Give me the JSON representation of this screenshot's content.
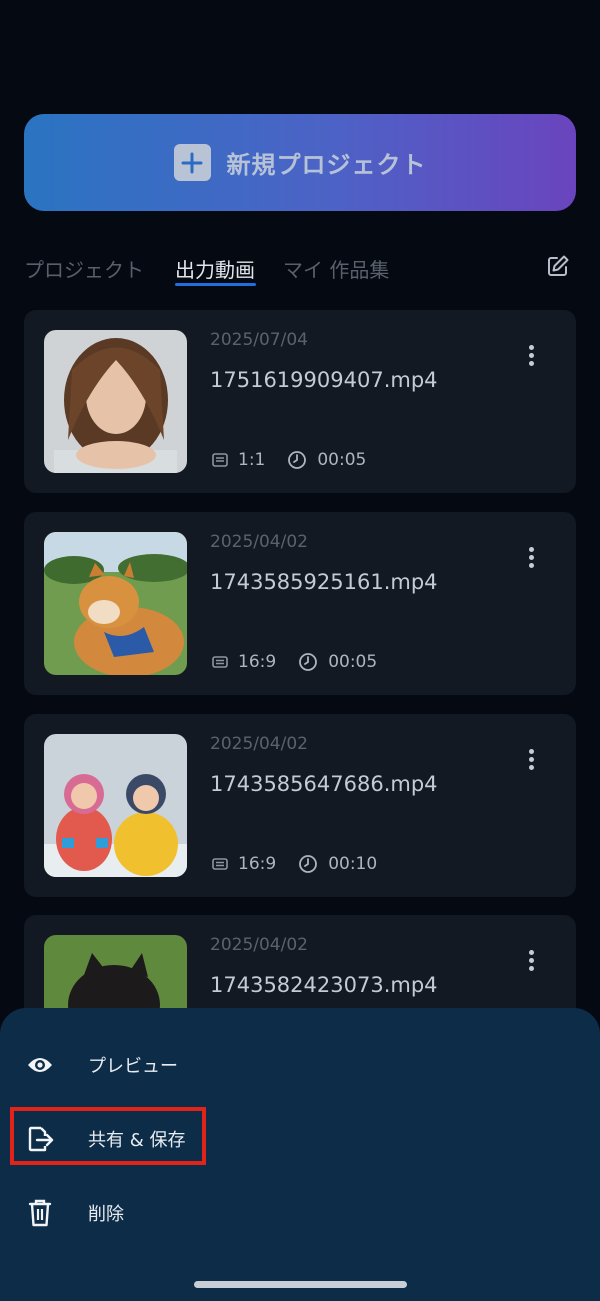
{
  "header": {
    "new_project_label": "新規プロジェクト"
  },
  "tabs": [
    {
      "label": "プロジェクト",
      "active": false
    },
    {
      "label": "出力動画",
      "active": true
    },
    {
      "label": "マイ 作品集",
      "active": false
    }
  ],
  "videos": [
    {
      "date": "2025/07/04",
      "filename": "1751619909407.mp4",
      "ratio": "1:1",
      "duration": "00:05",
      "thumb": "woman-portrait"
    },
    {
      "date": "2025/04/02",
      "filename": "1743585925161.mp4",
      "ratio": "16:9",
      "duration": "00:05",
      "thumb": "shiba-dog"
    },
    {
      "date": "2025/04/02",
      "filename": "1743585647686.mp4",
      "ratio": "16:9",
      "duration": "00:10",
      "thumb": "kids-in-snow"
    },
    {
      "date": "2025/04/02",
      "filename": "1743582423073.mp4",
      "ratio": "",
      "duration": "",
      "thumb": "black-shiba-dog"
    }
  ],
  "sheet": {
    "items": [
      {
        "label": "プレビュー",
        "icon": "eye-icon"
      },
      {
        "label": "共有 & 保存",
        "icon": "share-export-icon",
        "highlighted": true
      },
      {
        "label": "削除",
        "icon": "trash-icon"
      }
    ]
  },
  "colors": {
    "background": "#040912",
    "card": "#131923",
    "accent": "#1f6fe0",
    "sheet": "#0c2c47",
    "highlight": "#e0231b"
  }
}
